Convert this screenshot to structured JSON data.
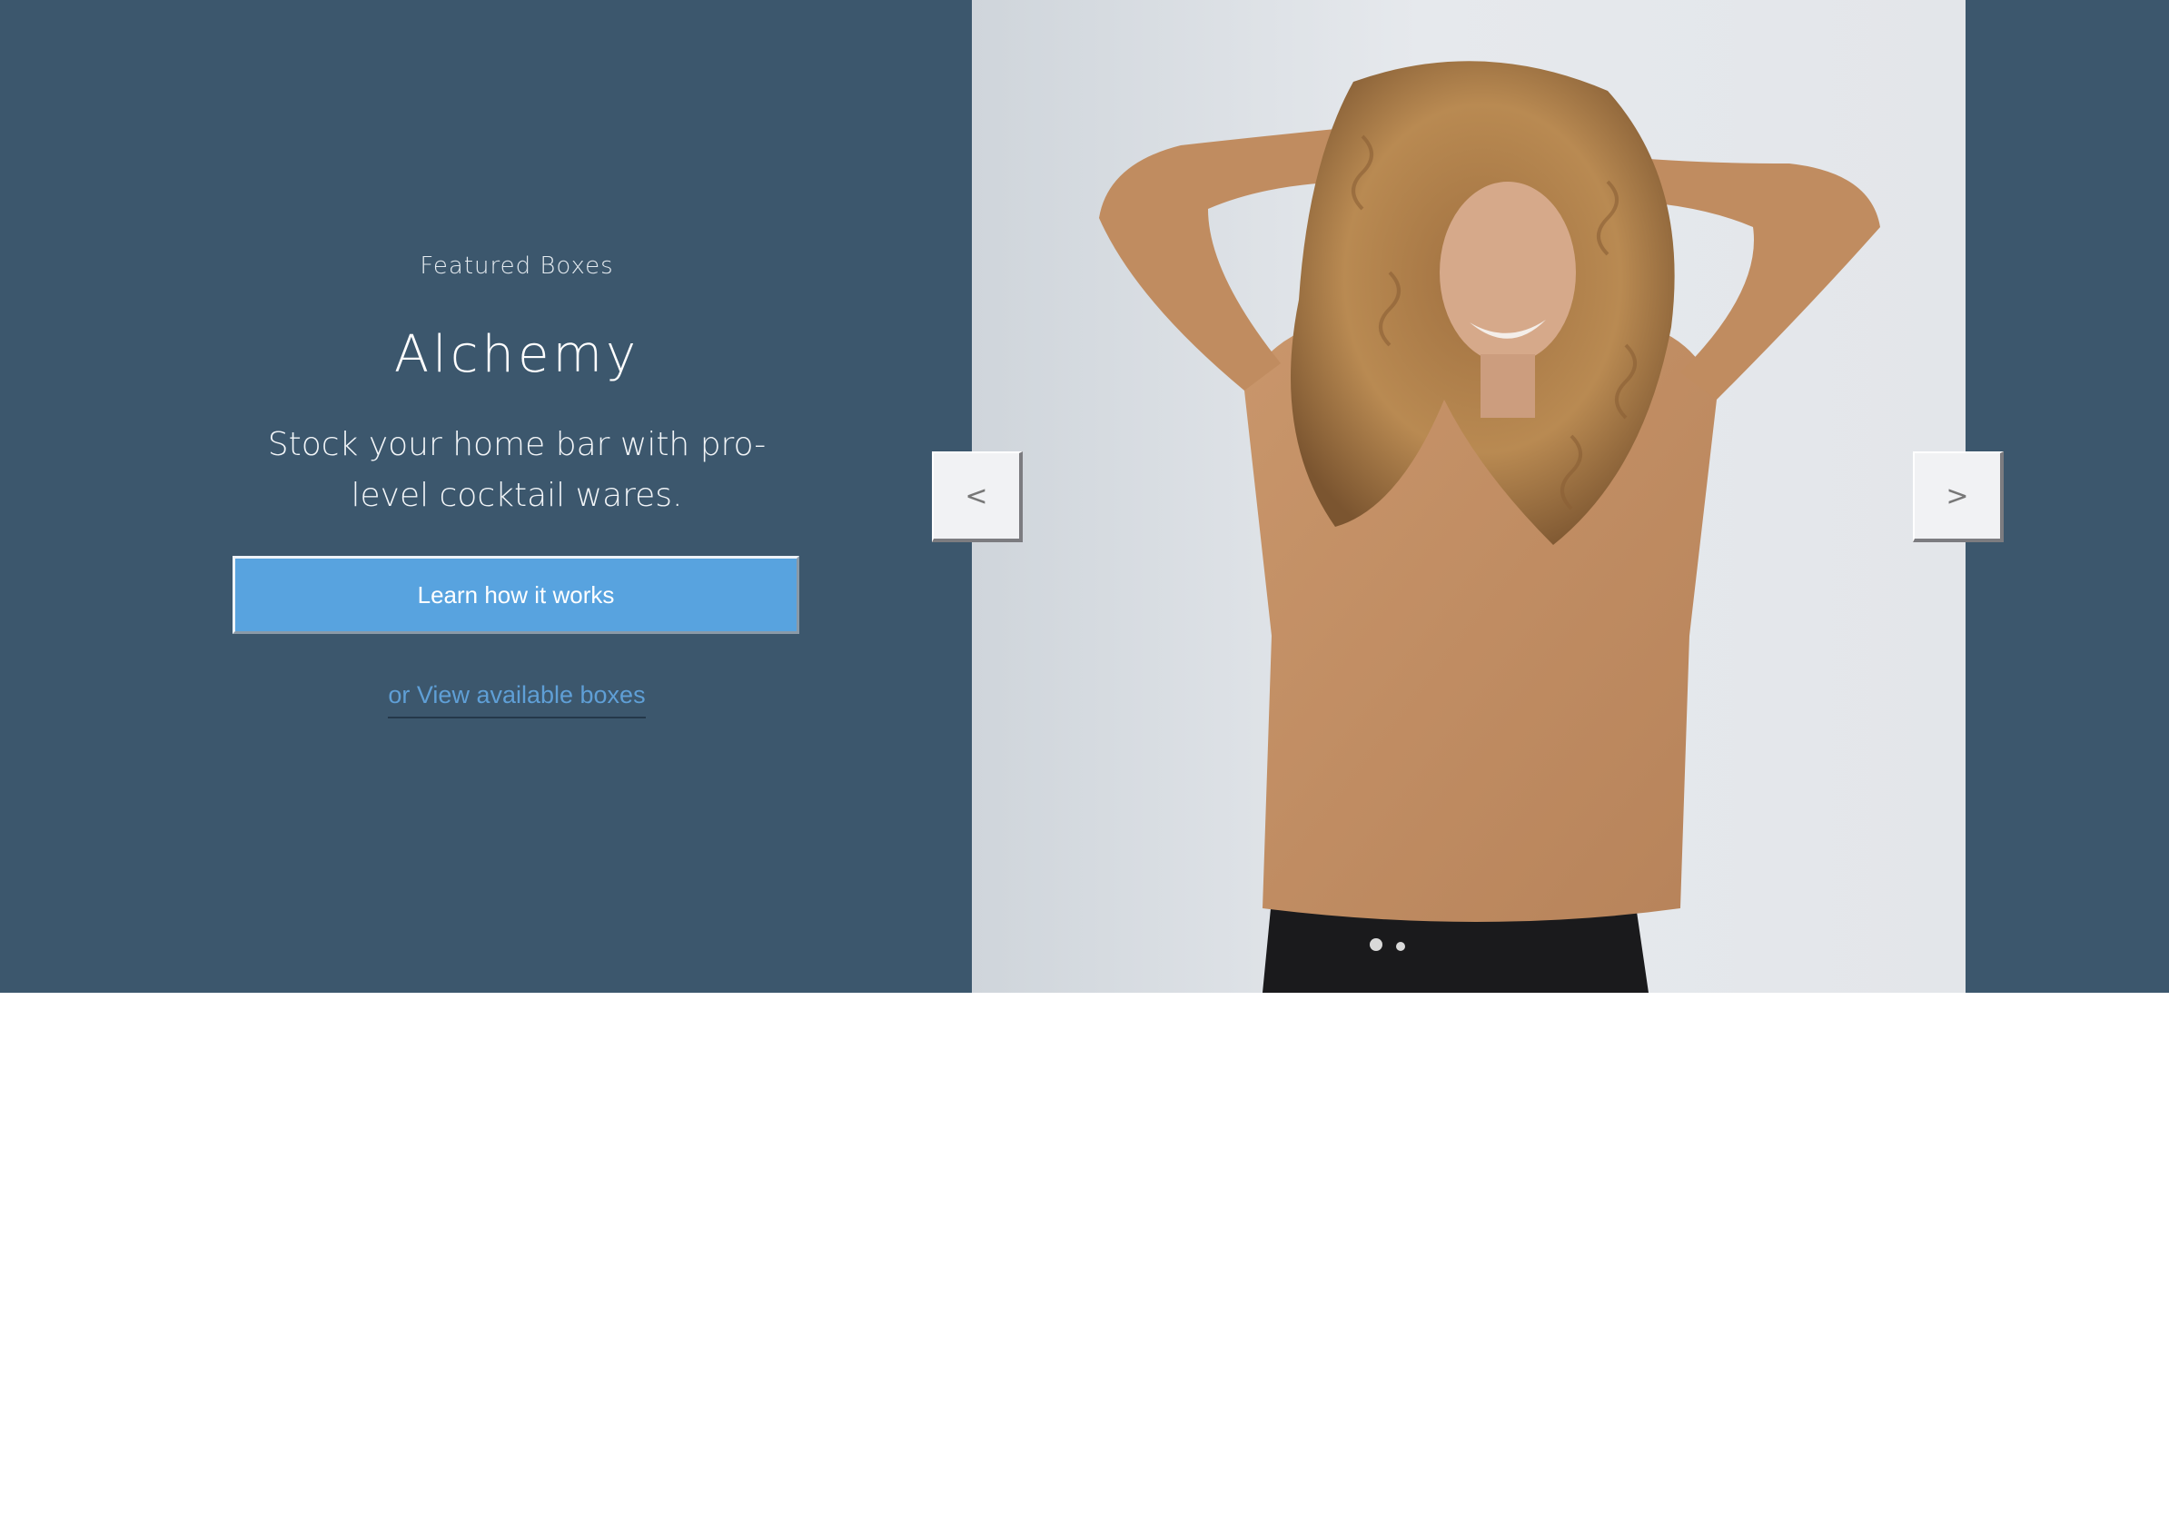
{
  "hero": {
    "eyebrow": "Featured Boxes",
    "title": "Alchemy",
    "subtitle": "Stock your home bar with pro-level cocktail wares.",
    "cta_label": "Learn how it works",
    "secondary_link": "or View available boxes"
  },
  "carousel": {
    "prev_glyph": "<",
    "next_glyph": ">",
    "prev_icon": "chevron-left-icon",
    "next_icon": "chevron-right-icon"
  },
  "colors": {
    "hero_background": "#3c576d",
    "cta_background": "#58a3df",
    "link": "#5f9fd6",
    "page_background": "#ffffff"
  }
}
